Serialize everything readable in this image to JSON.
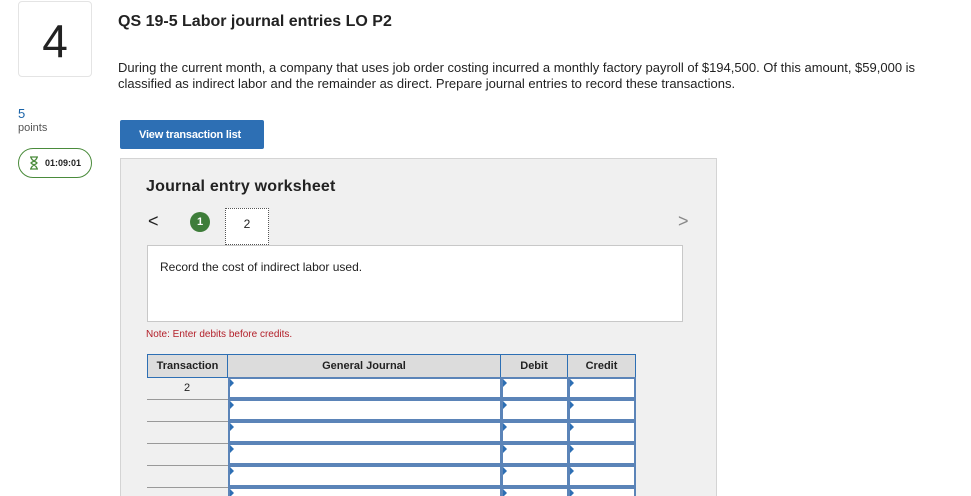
{
  "question": {
    "number": "4",
    "points_value": "5",
    "points_label": "points",
    "timer": "01:09:01"
  },
  "title": "QS 19-5 Labor journal entries LO P2",
  "description": "During the current month, a company that uses job order costing incurred a monthly factory payroll of $194,500. Of this amount, $59,000 is classified as indirect labor and the remainder as direct. Prepare journal entries to record these transactions.",
  "view_button": "View transaction list",
  "worksheet": {
    "title": "Journal entry worksheet",
    "prev_icon": "<",
    "next_icon": ">",
    "steps": [
      "1",
      "2"
    ],
    "current_step": "2",
    "instruction": "Record the cost of indirect labor used.",
    "note": "Note: Enter debits before credits."
  },
  "table": {
    "headers": {
      "transaction": "Transaction",
      "journal": "General Journal",
      "debit": "Debit",
      "credit": "Credit"
    },
    "rows": [
      {
        "transaction": "2",
        "account": "",
        "debit": "",
        "credit": ""
      },
      {
        "transaction": "",
        "account": "",
        "debit": "",
        "credit": ""
      },
      {
        "transaction": "",
        "account": "",
        "debit": "",
        "credit": ""
      },
      {
        "transaction": "",
        "account": "",
        "debit": "",
        "credit": ""
      },
      {
        "transaction": "",
        "account": "",
        "debit": "",
        "credit": ""
      },
      {
        "transaction": "",
        "account": "",
        "debit": "",
        "credit": ""
      }
    ]
  },
  "colors": {
    "accent": "#2d6fb4",
    "step_done": "#3e7d3a",
    "note": "#b3202a"
  }
}
